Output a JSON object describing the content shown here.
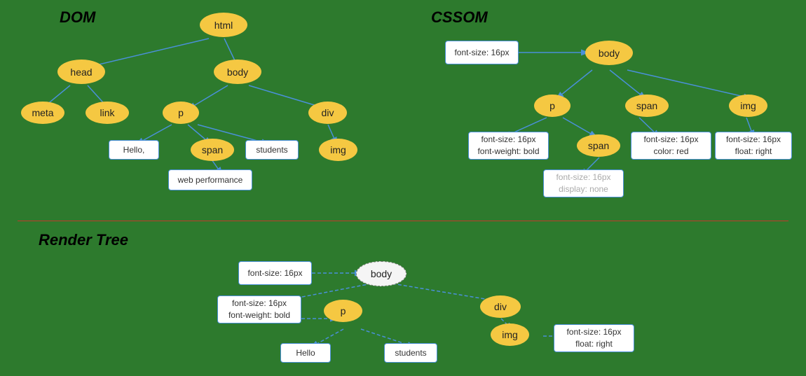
{
  "titles": {
    "dom": "DOM",
    "cssom": "CSSOM",
    "render_tree": "Render Tree"
  },
  "dom_nodes": {
    "html": "html",
    "head": "head",
    "body": "body",
    "meta": "meta",
    "link": "link",
    "p": "p",
    "div": "div",
    "span": "span",
    "img": "img",
    "hello": "Hello,",
    "students": "students",
    "web_performance": "web performance"
  },
  "cssom_nodes": {
    "body": "body",
    "p": "p",
    "span_top": "span",
    "img": "img",
    "span_inner": "span",
    "font_size_body": "font-size: 16px",
    "font_size_p": "font-size: 16px\nfont-weight: bold",
    "font_size_span_top": "font-size: 16px\ncolor: red",
    "font_size_img": "font-size: 16px\nfloat: right",
    "font_size_span_inner": "font-size: 16px\ndisplay: none"
  },
  "render_nodes": {
    "body": "body",
    "p": "p",
    "div": "div",
    "img": "img",
    "hello": "Hello",
    "students": "students",
    "font_size_body": "font-size: 16px",
    "font_size_p": "font-size: 16px\nfont-weight: bold",
    "font_size_img": "font-size: 16px\nfloat: right"
  }
}
